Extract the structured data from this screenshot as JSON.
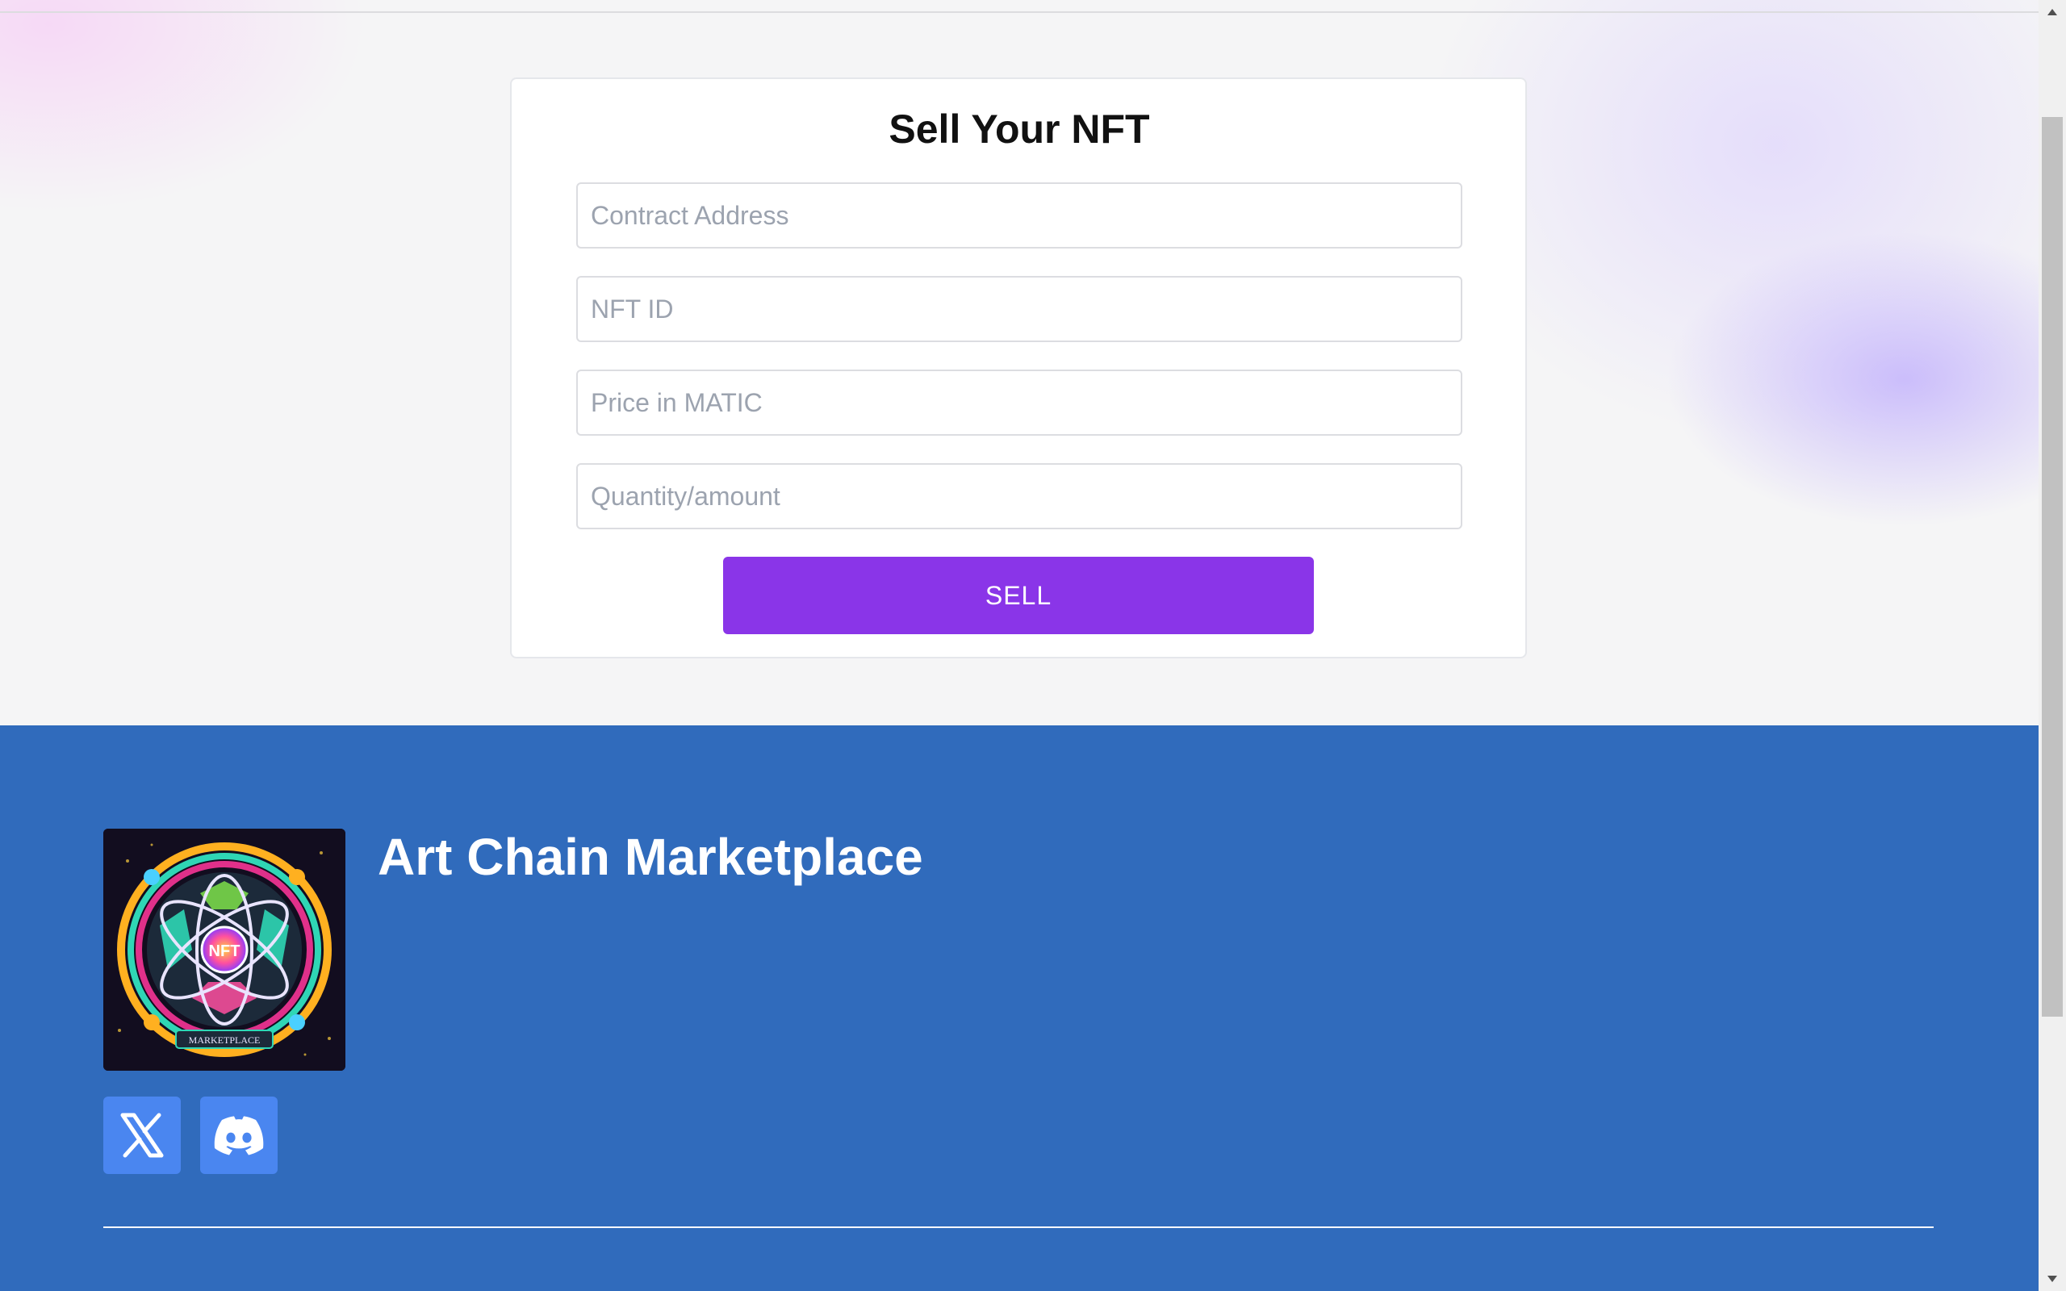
{
  "sell_form": {
    "title": "Sell Your NFT",
    "contract_address_placeholder": "Contract Address",
    "contract_address_value": "",
    "nft_id_placeholder": "NFT ID",
    "nft_id_value": "",
    "price_placeholder": "Price in MATIC",
    "price_value": "",
    "quantity_placeholder": "Quantity/amount",
    "quantity_value": "",
    "sell_button_label": "SELL"
  },
  "footer": {
    "brand_name": "Art Chain Marketplace",
    "logo_text": "NFT",
    "logo_ring_text": "MARKETPLACE",
    "social": [
      {
        "name": "x",
        "icon": "x-logo-icon"
      },
      {
        "name": "discord",
        "icon": "discord-icon"
      }
    ],
    "partial_heading": ""
  },
  "colors": {
    "accent_purple": "#8a35e8",
    "footer_blue": "#306bbc",
    "social_button_blue": "#4a86f0",
    "page_background": "#f5f5f6"
  }
}
